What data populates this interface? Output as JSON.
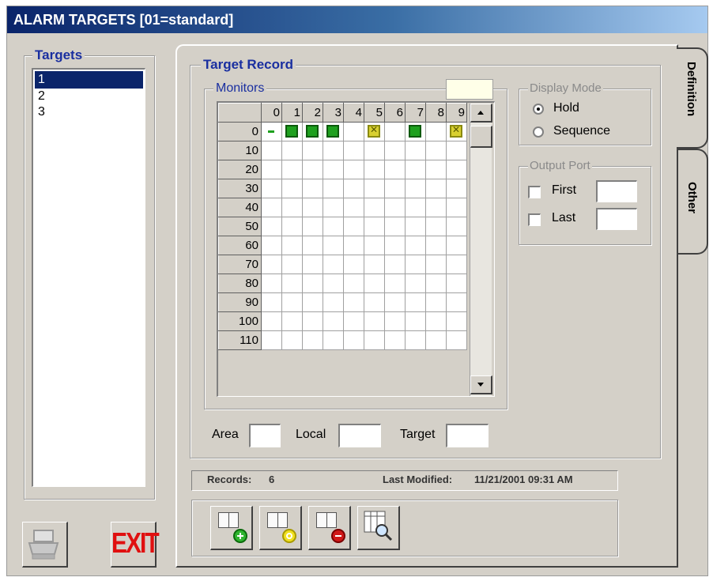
{
  "window": {
    "title": "ALARM TARGETS  [01=standard]"
  },
  "targets": {
    "legend": "Targets",
    "items": [
      "1",
      "2",
      "3"
    ],
    "selected": "1"
  },
  "record": {
    "legend": "Target Record"
  },
  "monitors": {
    "legend": "Monitors",
    "col_headers": [
      "0",
      "1",
      "2",
      "3",
      "4",
      "5",
      "6",
      "7",
      "8",
      "9"
    ],
    "row_headers": [
      "0",
      "10",
      "20",
      "30",
      "40",
      "50",
      "60",
      "70",
      "80",
      "90",
      "100",
      "110"
    ],
    "markers": [
      {
        "row": 0,
        "col": 0,
        "state": "dash"
      },
      {
        "row": 0,
        "col": 1,
        "state": "green"
      },
      {
        "row": 0,
        "col": 2,
        "state": "green"
      },
      {
        "row": 0,
        "col": 3,
        "state": "green"
      },
      {
        "row": 0,
        "col": 5,
        "state": "yellow"
      },
      {
        "row": 0,
        "col": 7,
        "state": "green"
      },
      {
        "row": 0,
        "col": 9,
        "state": "yellow"
      }
    ],
    "colors": {
      "green": "#1ea01e",
      "yellow": "#d8d030"
    }
  },
  "display_mode": {
    "legend": "Display Mode",
    "options": [
      "Hold",
      "Sequence"
    ],
    "selected": "Hold"
  },
  "output_port": {
    "legend": "Output Port",
    "first_label": "First",
    "last_label": "Last",
    "first_value": "",
    "last_value": ""
  },
  "fields": {
    "area_label": "Area",
    "local_label": "Local",
    "target_label": "Target",
    "area_value": "",
    "local_value": "",
    "target_value": ""
  },
  "status": {
    "records_label": "Records:",
    "records_value": "6",
    "modified_label": "Last Modified:",
    "modified_value": "11/21/2001 09:31 AM"
  },
  "tabs": [
    "Definition",
    "Other"
  ],
  "toolbar": {
    "buttons": [
      "add-record-icon",
      "edit-record-icon",
      "delete-record-icon",
      "search-grid-icon"
    ]
  },
  "bottom": {
    "exit_label": "EXIT"
  }
}
